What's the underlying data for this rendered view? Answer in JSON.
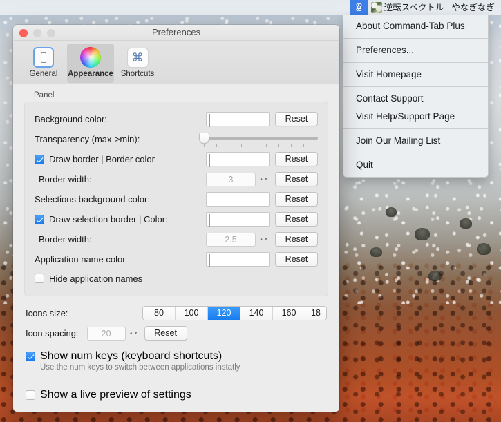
{
  "menubar": {
    "app_icon": "command-tab-plus-icon",
    "now_playing_icon": "album-art-thumbnail",
    "now_playing": "逆転スペクトル - やなぎなぎ"
  },
  "menu": {
    "groups": [
      [
        "About Command-Tab Plus"
      ],
      [
        "Preferences..."
      ],
      [
        "Visit Homepage"
      ],
      [
        "Contact Support",
        "Visit Help/Support Page"
      ],
      [
        "Join Our Mailing List"
      ],
      [
        "Quit"
      ]
    ]
  },
  "window": {
    "title": "Preferences",
    "traffic_lights": [
      "close",
      "minimize",
      "zoom"
    ],
    "toolbar": {
      "tabs": [
        {
          "label": "General",
          "icon": "device-icon",
          "selected": false
        },
        {
          "label": "Appearance",
          "icon": "color-wheel-icon",
          "selected": true
        },
        {
          "label": "Shortcuts",
          "icon": "command-key-icon",
          "selected": false
        }
      ]
    },
    "panel": {
      "group_label": "Panel",
      "rows": {
        "background_color": {
          "label": "Background color:",
          "swatch": "gradient-dark-gray",
          "colors": [
            "#3c3c3c",
            "#6e6e6e"
          ],
          "reset": "Reset"
        },
        "transparency": {
          "label": "Transparency (max->min):",
          "value": 0,
          "ticks": 10
        },
        "draw_border": {
          "label": "Draw border | Border color",
          "checked": true,
          "swatch": "white",
          "color": "#ffffff",
          "reset": "Reset"
        },
        "border_width": {
          "label": "Border width:",
          "value": "3",
          "disabled": true,
          "reset": "Reset"
        },
        "selections_background_color": {
          "label": "Selections background color:",
          "swatch": "black",
          "color": "#000000",
          "reset": "Reset"
        },
        "draw_selection_border": {
          "label": "Draw selection border | Color:",
          "checked": true,
          "swatch": "white",
          "color": "#ffffff",
          "reset": "Reset"
        },
        "selection_border_width": {
          "label": "Border width:",
          "value": "2.5",
          "disabled": true,
          "reset": "Reset"
        },
        "application_name_color": {
          "label": "Application name color",
          "swatch": "white",
          "color": "#ffffff",
          "reset": "Reset"
        },
        "hide_application_names": {
          "label": "Hide application names",
          "checked": false
        }
      }
    },
    "icons_size": {
      "label": "Icons size:",
      "options": [
        "80",
        "100",
        "120",
        "140",
        "160",
        "18"
      ],
      "selected": "120"
    },
    "icon_spacing": {
      "label": "Icon spacing:",
      "value": "20",
      "disabled": true,
      "reset": "Reset"
    },
    "num_keys": {
      "label": "Show num keys (keyboard shortcuts)",
      "checked": true,
      "description": "Use the num keys to switch between applications instatly"
    },
    "live_preview": {
      "label": "Show a live preview of settings",
      "checked": false
    }
  },
  "colors": {
    "accent": "#1a7df0",
    "window_bg": "#ececec",
    "group_bg": "#e6e6e6"
  }
}
